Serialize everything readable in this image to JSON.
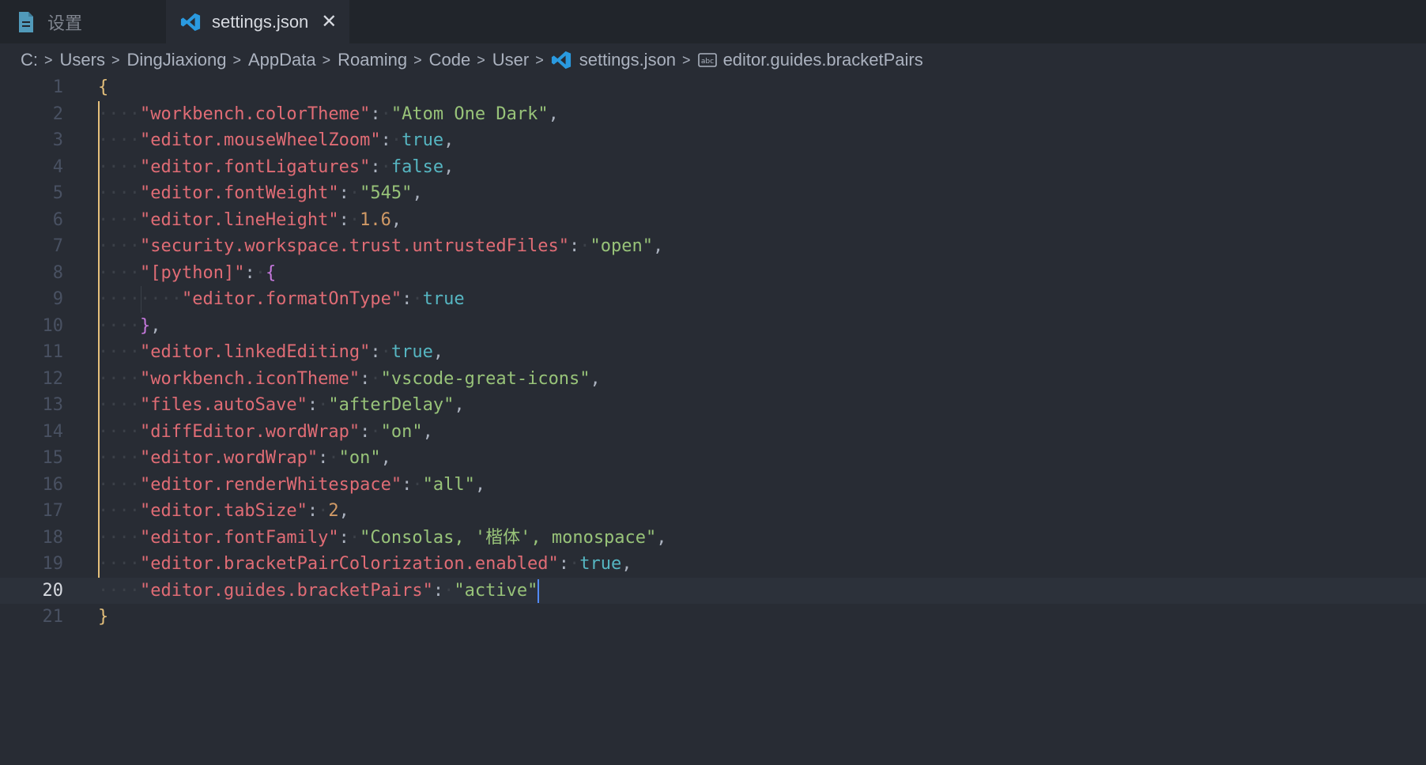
{
  "tabs": [
    {
      "label": "设置",
      "icon": "file-icon"
    },
    {
      "label": "settings.json",
      "icon": "vscode-icon",
      "close": "✕"
    }
  ],
  "breadcrumbs": [
    "C:",
    "Users",
    "DingJiaxiong",
    "AppData",
    "Roaming",
    "Code",
    "User",
    "settings.json",
    "editor.guides.bracketPairs"
  ],
  "breadcrumb_separator": ">",
  "editor": {
    "current_line": 20,
    "line_numbers": [
      "1",
      "2",
      "3",
      "4",
      "5",
      "6",
      "7",
      "8",
      "9",
      "10",
      "11",
      "12",
      "13",
      "14",
      "15",
      "16",
      "17",
      "18",
      "19",
      "20",
      "21"
    ]
  },
  "code": {
    "open_brace": "{",
    "close_brace": "}",
    "entries": [
      {
        "key": "\"workbench.colorTheme\"",
        "value": "\"Atom One Dark\"",
        "vtype": "str",
        "comma": ","
      },
      {
        "key": "\"editor.mouseWheelZoom\"",
        "value": "true",
        "vtype": "bool",
        "comma": ","
      },
      {
        "key": "\"editor.fontLigatures\"",
        "value": "false",
        "vtype": "bool",
        "comma": ","
      },
      {
        "key": "\"editor.fontWeight\"",
        "value": "\"545\"",
        "vtype": "str",
        "comma": ","
      },
      {
        "key": "\"editor.lineHeight\"",
        "value": "1.6",
        "vtype": "num",
        "comma": ","
      },
      {
        "key": "\"security.workspace.trust.untrustedFiles\"",
        "value": "\"open\"",
        "vtype": "str",
        "comma": ","
      }
    ],
    "python_key": "\"[python]\"",
    "python_open": "{",
    "python_inner_key": "\"editor.formatOnType\"",
    "python_inner_value": "true",
    "python_close": "},",
    "entries2": [
      {
        "key": "\"editor.linkedEditing\"",
        "value": "true",
        "vtype": "bool",
        "comma": ","
      },
      {
        "key": "\"workbench.iconTheme\"",
        "value": "\"vscode-great-icons\"",
        "vtype": "str",
        "comma": ","
      },
      {
        "key": "\"files.autoSave\"",
        "value": "\"afterDelay\"",
        "vtype": "str",
        "comma": ","
      },
      {
        "key": "\"diffEditor.wordWrap\"",
        "value": "\"on\"",
        "vtype": "str",
        "comma": ","
      },
      {
        "key": "\"editor.wordWrap\"",
        "value": "\"on\"",
        "vtype": "str",
        "comma": ","
      },
      {
        "key": "\"editor.renderWhitespace\"",
        "value": "\"all\"",
        "vtype": "str",
        "comma": ","
      },
      {
        "key": "\"editor.tabSize\"",
        "value": "2",
        "vtype": "num",
        "comma": ","
      },
      {
        "key": "\"editor.fontFamily\"",
        "value": "\"Consolas, '楷体', monospace\"",
        "vtype": "str",
        "comma": ","
      },
      {
        "key": "\"editor.bracketPairColorization.enabled\"",
        "value": "true",
        "vtype": "bool",
        "comma": ","
      },
      {
        "key": "\"editor.guides.bracketPairs\"",
        "value": "\"active\"",
        "vtype": "str",
        "comma": ""
      }
    ]
  },
  "colors": {
    "background": "#282c34",
    "key": "#e06c75",
    "string": "#98c379",
    "boolean": "#56b6c2",
    "number": "#d19a66",
    "bracket_level1": "#e5c07b",
    "bracket_level2": "#c678dd"
  }
}
